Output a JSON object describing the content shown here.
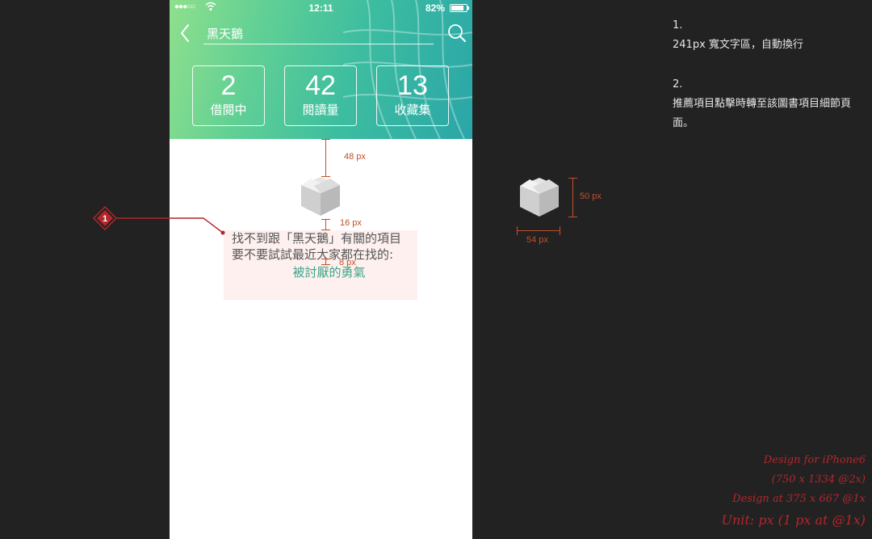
{
  "status_bar": {
    "signal": "●●●○○",
    "time": "12:11",
    "battery": "82%"
  },
  "search": {
    "query": "黑天鵝"
  },
  "stats": [
    {
      "value": "2",
      "label": "借閱中"
    },
    {
      "value": "42",
      "label": "閱讀量"
    },
    {
      "value": "13",
      "label": "收藏集"
    }
  ],
  "empty_state": {
    "line1": "找不到跟「黑天鵝」有關的項目",
    "line2": "要不要試試最近大家都在找的:",
    "suggestion": "被討厭的勇氣"
  },
  "spec": {
    "top_gap": "48 px",
    "icon_gap": "16 px",
    "link_gap": "8 px",
    "icon_height": "50 px",
    "icon_width": "54 px",
    "marker": "1"
  },
  "notes": {
    "n1_index": "1.",
    "n1_text": "241px 寬文字區，自動換行",
    "n2_index": "2.",
    "n2_text": "推薦項目點擊時轉至該圖書項目細節頁面。"
  },
  "design_info": {
    "line1": "Design for iPhone6",
    "line2": "(750 x 1334 @2x)",
    "line3": "Design at 375 x 667 @1x",
    "line4": "Unit: px (1 px at @1x)"
  },
  "colors": {
    "accent": "#3aa58a",
    "annotation": "#c0502a",
    "marker": "#b3262b"
  }
}
